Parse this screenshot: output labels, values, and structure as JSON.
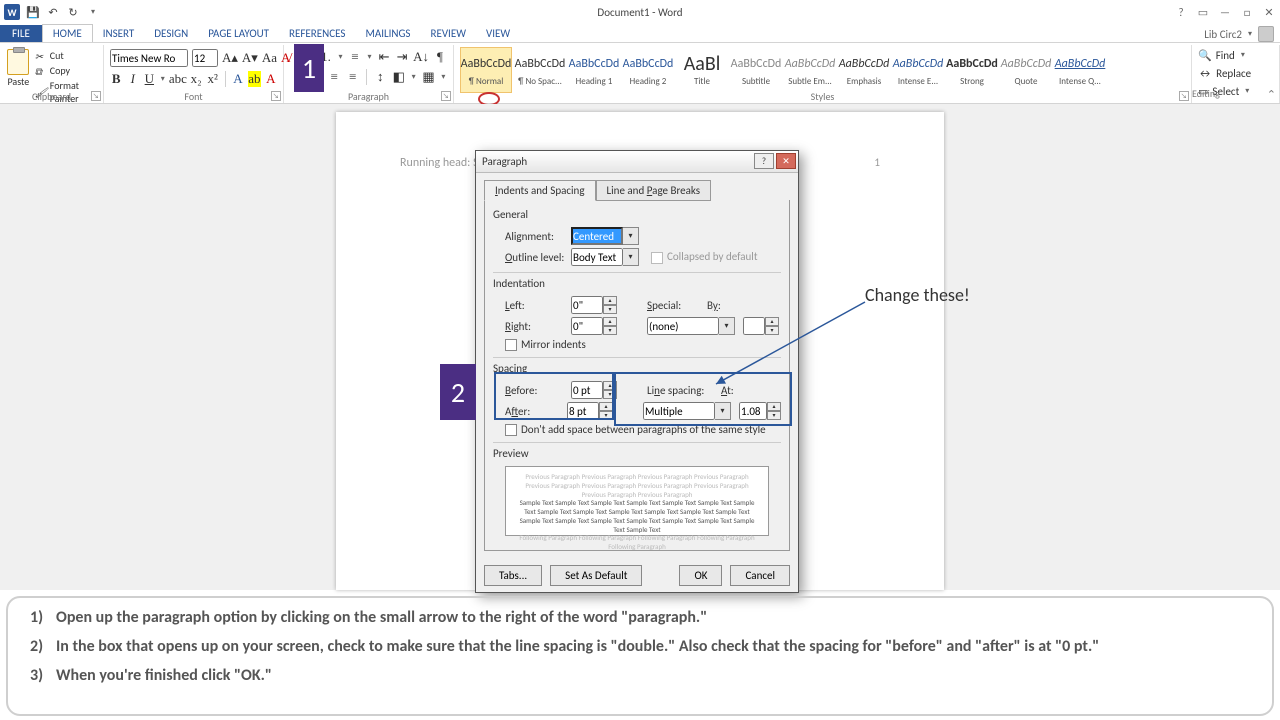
{
  "titlebar": {
    "doc": "Document1 - Word",
    "user": "Lib Circ2"
  },
  "tabs": [
    "FILE",
    "HOME",
    "INSERT",
    "DESIGN",
    "PAGE LAYOUT",
    "REFERENCES",
    "MAILINGS",
    "REVIEW",
    "VIEW"
  ],
  "ribbon": {
    "clipboard": {
      "paste": "Paste",
      "cut": "Cut",
      "copy": "Copy",
      "fmtpainter": "Format Painter",
      "label": "Clipboard"
    },
    "font": {
      "family": "Times New Ro",
      "size": "12",
      "label": "Font"
    },
    "paragraph": {
      "label": "Paragraph"
    },
    "styles": {
      "label": "Styles",
      "items": [
        {
          "preview": "AaBbCcDd",
          "name": "¶ Normal",
          "u": false
        },
        {
          "preview": "AaBbCcDd",
          "name": "¶ No Spac...",
          "u": false
        },
        {
          "preview": "AaBbCcDd",
          "name": "Heading 1",
          "u": false,
          "color": "#2b579a"
        },
        {
          "preview": "AaBbCcDd",
          "name": "Heading 2",
          "u": false,
          "color": "#2b579a"
        },
        {
          "preview": "AaBl",
          "name": "Title",
          "u": false,
          "big": true
        },
        {
          "preview": "AaBbCcDd",
          "name": "Subtitle",
          "u": false,
          "color": "#888"
        },
        {
          "preview": "AaBbCcDd",
          "name": "Subtle Em...",
          "u": false,
          "italic": true,
          "color": "#888"
        },
        {
          "preview": "AaBbCcDd",
          "name": "Emphasis",
          "u": false,
          "italic": true
        },
        {
          "preview": "AaBbCcDd",
          "name": "Intense E...",
          "u": false,
          "italic": true,
          "color": "#2b579a"
        },
        {
          "preview": "AaBbCcDd",
          "name": "Strong",
          "u": false,
          "bold": true
        },
        {
          "preview": "AaBbCcDd",
          "name": "Quote",
          "u": false,
          "italic": true,
          "color": "#888"
        },
        {
          "preview": "AaBbCcDd",
          "name": "Intense Q...",
          "u": true,
          "italic": true,
          "color": "#2b579a"
        }
      ]
    },
    "editing": {
      "find": "Find",
      "replace": "Replace",
      "select": "Select",
      "label": "Editing"
    }
  },
  "page": {
    "header": "Running head: SAMPLE APA PAPER",
    "pgnum": "1"
  },
  "dialog": {
    "title": "Paragraph",
    "tab1": "Indents and Spacing",
    "tab2": "Line and Page Breaks",
    "general": "General",
    "alignment_l": "Alignment:",
    "alignment_v": "Centered",
    "outline_l": "Outline level:",
    "outline_v": "Body Text",
    "collapsed": "Collapsed by default",
    "indent": "Indentation",
    "left_l": "Left:",
    "left_v": "0\"",
    "right_l": "Right:",
    "right_v": "0\"",
    "special_l": "Special:",
    "special_v": "(none)",
    "by_l": "By:",
    "by_v": "",
    "mirror": "Mirror indents",
    "spacing": "Spacing",
    "before_l": "Before:",
    "before_v": "0 pt",
    "after_l": "After:",
    "after_v": "8 pt",
    "linesp_l": "Line spacing:",
    "linesp_v": "Multiple",
    "at_l": "At:",
    "at_v": "1.08",
    "noadd": "Don't add space between paragraphs of the same style",
    "preview": "Preview",
    "tabs_btn": "Tabs...",
    "default_btn": "Set As Default",
    "ok": "OK",
    "cancel": "Cancel",
    "pf": "Previous Paragraph Previous Paragraph Previous Paragraph Previous Paragraph Previous Paragraph Previous Paragraph Previous Paragraph Previous Paragraph Previous Paragraph Previous Paragraph",
    "tx": "Sample Text Sample Text Sample Text Sample Text Sample Text Sample Text Sample Text Sample Text Sample Text Sample Text Sample Text Sample Text Sample Text Sample Text Sample Text Sample Text Sample Text Sample Text Sample Text Sample Text Sample Text",
    "nf": "Following Paragraph Following Paragraph Following Paragraph Following Paragraph Following Paragraph"
  },
  "annot": "Change these!",
  "callouts": {
    "c1": "1",
    "c2": "2"
  },
  "instr": [
    "Open up the paragraph  option by clicking on the small arrow to the right of the word \"paragraph.\"",
    "In the box that opens up on your screen, check to make sure that the line spacing is \"double.\"  Also check that the spacing for \"before\" and \"after\" is at \"0 pt.\"",
    "When you're finished click \"OK.\""
  ]
}
